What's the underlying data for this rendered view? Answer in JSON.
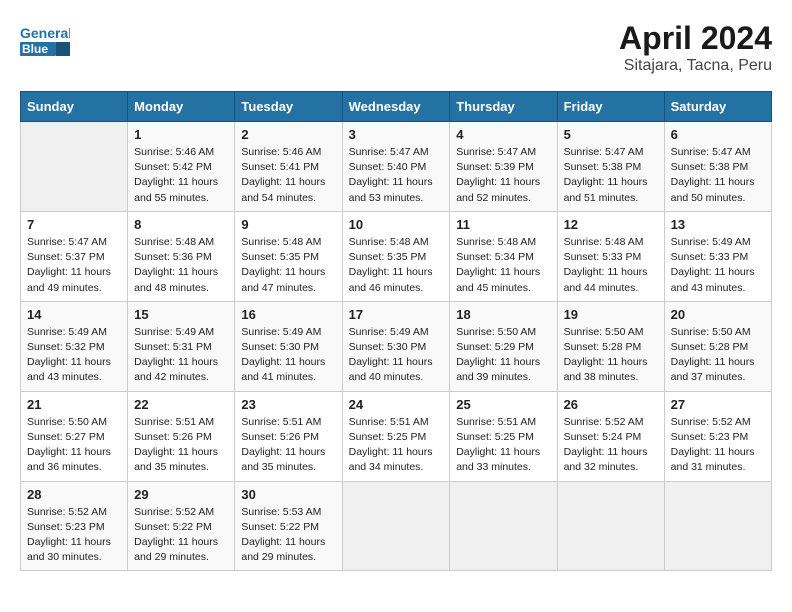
{
  "header": {
    "logo_line1": "General",
    "logo_line2": "Blue",
    "title": "April 2024",
    "subtitle": "Sitajara, Tacna, Peru"
  },
  "days_of_week": [
    "Sunday",
    "Monday",
    "Tuesday",
    "Wednesday",
    "Thursday",
    "Friday",
    "Saturday"
  ],
  "weeks": [
    [
      {
        "day": "",
        "info": ""
      },
      {
        "day": "1",
        "info": "Sunrise: 5:46 AM\nSunset: 5:42 PM\nDaylight: 11 hours\nand 55 minutes."
      },
      {
        "day": "2",
        "info": "Sunrise: 5:46 AM\nSunset: 5:41 PM\nDaylight: 11 hours\nand 54 minutes."
      },
      {
        "day": "3",
        "info": "Sunrise: 5:47 AM\nSunset: 5:40 PM\nDaylight: 11 hours\nand 53 minutes."
      },
      {
        "day": "4",
        "info": "Sunrise: 5:47 AM\nSunset: 5:39 PM\nDaylight: 11 hours\nand 52 minutes."
      },
      {
        "day": "5",
        "info": "Sunrise: 5:47 AM\nSunset: 5:38 PM\nDaylight: 11 hours\nand 51 minutes."
      },
      {
        "day": "6",
        "info": "Sunrise: 5:47 AM\nSunset: 5:38 PM\nDaylight: 11 hours\nand 50 minutes."
      }
    ],
    [
      {
        "day": "7",
        "info": "Sunrise: 5:47 AM\nSunset: 5:37 PM\nDaylight: 11 hours\nand 49 minutes."
      },
      {
        "day": "8",
        "info": "Sunrise: 5:48 AM\nSunset: 5:36 PM\nDaylight: 11 hours\nand 48 minutes."
      },
      {
        "day": "9",
        "info": "Sunrise: 5:48 AM\nSunset: 5:35 PM\nDaylight: 11 hours\nand 47 minutes."
      },
      {
        "day": "10",
        "info": "Sunrise: 5:48 AM\nSunset: 5:35 PM\nDaylight: 11 hours\nand 46 minutes."
      },
      {
        "day": "11",
        "info": "Sunrise: 5:48 AM\nSunset: 5:34 PM\nDaylight: 11 hours\nand 45 minutes."
      },
      {
        "day": "12",
        "info": "Sunrise: 5:48 AM\nSunset: 5:33 PM\nDaylight: 11 hours\nand 44 minutes."
      },
      {
        "day": "13",
        "info": "Sunrise: 5:49 AM\nSunset: 5:33 PM\nDaylight: 11 hours\nand 43 minutes."
      }
    ],
    [
      {
        "day": "14",
        "info": "Sunrise: 5:49 AM\nSunset: 5:32 PM\nDaylight: 11 hours\nand 43 minutes."
      },
      {
        "day": "15",
        "info": "Sunrise: 5:49 AM\nSunset: 5:31 PM\nDaylight: 11 hours\nand 42 minutes."
      },
      {
        "day": "16",
        "info": "Sunrise: 5:49 AM\nSunset: 5:30 PM\nDaylight: 11 hours\nand 41 minutes."
      },
      {
        "day": "17",
        "info": "Sunrise: 5:49 AM\nSunset: 5:30 PM\nDaylight: 11 hours\nand 40 minutes."
      },
      {
        "day": "18",
        "info": "Sunrise: 5:50 AM\nSunset: 5:29 PM\nDaylight: 11 hours\nand 39 minutes."
      },
      {
        "day": "19",
        "info": "Sunrise: 5:50 AM\nSunset: 5:28 PM\nDaylight: 11 hours\nand 38 minutes."
      },
      {
        "day": "20",
        "info": "Sunrise: 5:50 AM\nSunset: 5:28 PM\nDaylight: 11 hours\nand 37 minutes."
      }
    ],
    [
      {
        "day": "21",
        "info": "Sunrise: 5:50 AM\nSunset: 5:27 PM\nDaylight: 11 hours\nand 36 minutes."
      },
      {
        "day": "22",
        "info": "Sunrise: 5:51 AM\nSunset: 5:26 PM\nDaylight: 11 hours\nand 35 minutes."
      },
      {
        "day": "23",
        "info": "Sunrise: 5:51 AM\nSunset: 5:26 PM\nDaylight: 11 hours\nand 35 minutes."
      },
      {
        "day": "24",
        "info": "Sunrise: 5:51 AM\nSunset: 5:25 PM\nDaylight: 11 hours\nand 34 minutes."
      },
      {
        "day": "25",
        "info": "Sunrise: 5:51 AM\nSunset: 5:25 PM\nDaylight: 11 hours\nand 33 minutes."
      },
      {
        "day": "26",
        "info": "Sunrise: 5:52 AM\nSunset: 5:24 PM\nDaylight: 11 hours\nand 32 minutes."
      },
      {
        "day": "27",
        "info": "Sunrise: 5:52 AM\nSunset: 5:23 PM\nDaylight: 11 hours\nand 31 minutes."
      }
    ],
    [
      {
        "day": "28",
        "info": "Sunrise: 5:52 AM\nSunset: 5:23 PM\nDaylight: 11 hours\nand 30 minutes."
      },
      {
        "day": "29",
        "info": "Sunrise: 5:52 AM\nSunset: 5:22 PM\nDaylight: 11 hours\nand 29 minutes."
      },
      {
        "day": "30",
        "info": "Sunrise: 5:53 AM\nSunset: 5:22 PM\nDaylight: 11 hours\nand 29 minutes."
      },
      {
        "day": "",
        "info": ""
      },
      {
        "day": "",
        "info": ""
      },
      {
        "day": "",
        "info": ""
      },
      {
        "day": "",
        "info": ""
      }
    ]
  ]
}
